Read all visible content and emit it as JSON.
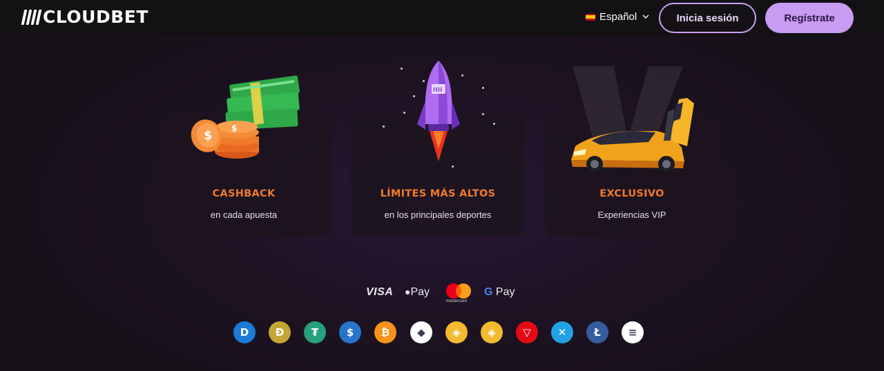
{
  "header": {
    "logo_text": "CLOUDBET",
    "language": "Español",
    "login_label": "Inicia sesión",
    "register_label": "Regístrate"
  },
  "cards": [
    {
      "title": "CASHBACK",
      "subtitle": "en cada apuesta",
      "illustration": "cash-coins"
    },
    {
      "title": "LÍMITES MÁS ALTOS",
      "subtitle": "en los principales deportes",
      "illustration": "rocket"
    },
    {
      "title": "EXCLUSIVO",
      "subtitle": "Experiencias VIP",
      "illustration": "sports-car"
    }
  ],
  "payments": {
    "visa": "VISA",
    "apple_pay": "Pay",
    "mastercard": "mastercard",
    "google_pay": "Pay"
  },
  "crypto": [
    {
      "name": "dash-icon",
      "symbol": "D",
      "color": "#1c7ad8"
    },
    {
      "name": "dogecoin-icon",
      "symbol": "Ð",
      "color": "#c2a633"
    },
    {
      "name": "tether-icon",
      "symbol": "₮",
      "color": "#26a17b"
    },
    {
      "name": "usdc-icon",
      "symbol": "$",
      "color": "#2775ca"
    },
    {
      "name": "bitcoin-icon",
      "symbol": "₿",
      "color": "#f7931a"
    },
    {
      "name": "ethereum-icon",
      "symbol": "◆",
      "color": "#ffffff"
    },
    {
      "name": "binance-icon",
      "symbol": "◈",
      "color": "#f3ba2f"
    },
    {
      "name": "bnb-icon",
      "symbol": "◈",
      "color": "#f3ba2f"
    },
    {
      "name": "tron-icon",
      "symbol": "▽",
      "color": "#e50914"
    },
    {
      "name": "ripple-icon",
      "symbol": "✕",
      "color": "#23a1e6"
    },
    {
      "name": "litecoin-icon",
      "symbol": "Ł",
      "color": "#345d9d"
    },
    {
      "name": "solana-icon",
      "symbol": "≡",
      "color": "#ffffff"
    }
  ]
}
